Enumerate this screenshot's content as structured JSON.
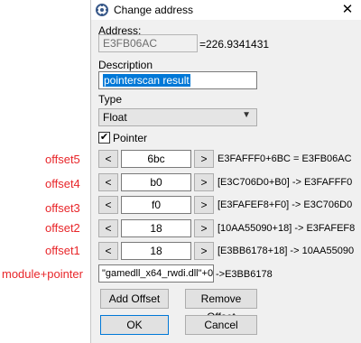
{
  "window": {
    "title": "Change address",
    "close_icon": "close-icon",
    "app_icon": "cheat-engine-icon"
  },
  "address": {
    "label": "Address:",
    "value": "E3FB06AC",
    "computed": "=226.9341431"
  },
  "description": {
    "label": "Description",
    "value": "pointerscan result"
  },
  "type": {
    "label": "Type",
    "value": "Float"
  },
  "pointer": {
    "label": "Pointer",
    "checked": true
  },
  "offsets": [
    {
      "annotation": "offset5",
      "value": "6bc",
      "result": "E3FAFFF0+6BC = E3FB06AC"
    },
    {
      "annotation": "offset4",
      "value": "b0",
      "result": "[E3C706D0+B0] -> E3FAFFF0"
    },
    {
      "annotation": "offset3",
      "value": "f0",
      "result": "[E3FAFEF8+F0] -> E3C706D0"
    },
    {
      "annotation": "offset2",
      "value": "18",
      "result": "[10AA55090+18] -> E3FAFEF8"
    },
    {
      "annotation": "offset1",
      "value": "18",
      "result": "[E3BB6178+18] -> 10AA55090"
    }
  ],
  "arrow_left": "<",
  "arrow_right": ">",
  "base": {
    "annotation": "module+pointer",
    "value": "\"gamedll_x64_rwdi.dll\"+0'",
    "result": "->E3BB6178"
  },
  "buttons": {
    "add_offset": "Add Offset",
    "remove_offset": "Remove Offset",
    "ok": "OK",
    "cancel": "Cancel"
  }
}
